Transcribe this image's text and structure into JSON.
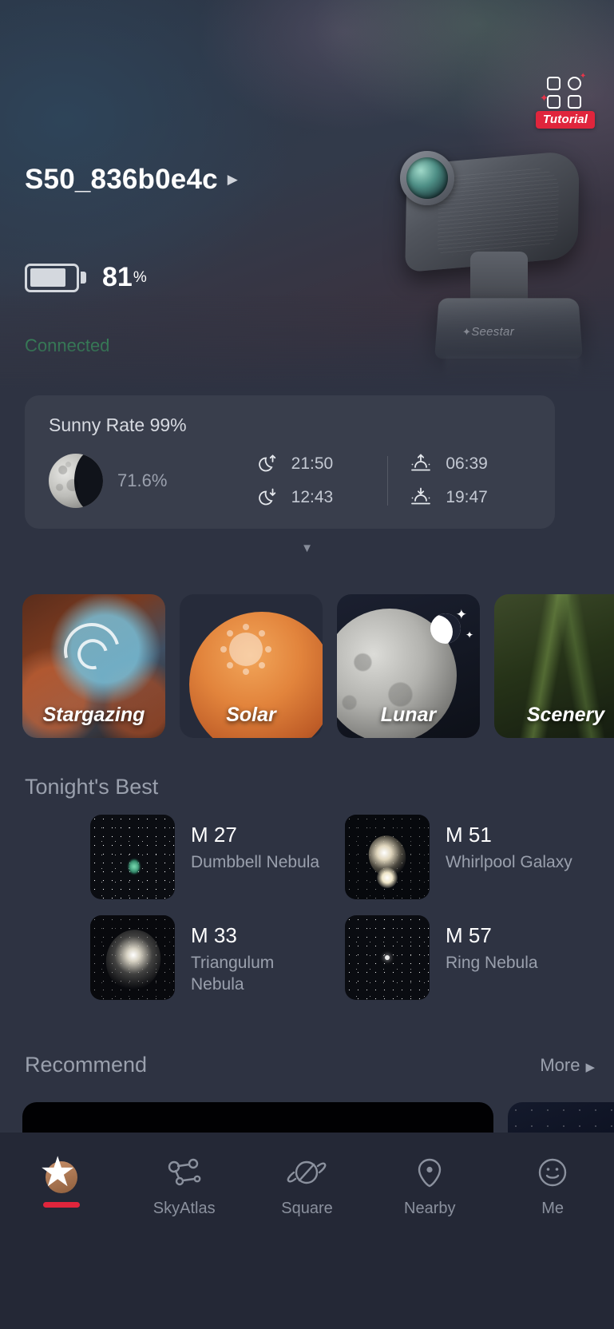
{
  "hero": {
    "tutorial": {
      "label": "Tutorial",
      "icon": "grid-sparkle-icon"
    },
    "device_name": "S50_836b0e4c",
    "device_arrow": "▶",
    "battery": {
      "percent": "81",
      "unit": "%",
      "level": 81
    },
    "connection_status": "Connected",
    "connection_color": "#3fc06a",
    "telescope_brand": "Seestar"
  },
  "info_card": {
    "sunny_rate": "Sunny Rate 99%",
    "moon_illumination": "71.6%",
    "times": [
      {
        "icon": "moonrise-icon",
        "value": "21:50"
      },
      {
        "icon": "moonset-icon",
        "value": "12:43"
      },
      {
        "icon": "sunrise-icon",
        "value": "06:39"
      },
      {
        "icon": "sunset-icon",
        "value": "19:47"
      }
    ],
    "expand_chevron": "⌄"
  },
  "categories": [
    {
      "label": "Stargazing",
      "icon": "galaxy-spiral-icon"
    },
    {
      "label": "Solar",
      "icon": "sun-icon"
    },
    {
      "label": "Lunar",
      "icon": "moon-crescent-icon"
    },
    {
      "label": "Scenery",
      "icon": "landscape-icon"
    }
  ],
  "tonight": {
    "title": "Tonight's Best",
    "objects": [
      {
        "id": "M 27",
        "name": "Dumbbell Nebula"
      },
      {
        "id": "M 51",
        "name": "Whirlpool Galaxy"
      },
      {
        "id": "M 33",
        "name": "Triangulum Nebula"
      },
      {
        "id": "M 57",
        "name": "Ring Nebula"
      }
    ]
  },
  "recommend": {
    "title": "Recommend",
    "more_label": "More",
    "more_arrow": "▶"
  },
  "tabbar": {
    "tabs": [
      {
        "label": "",
        "icon": "home-star-icon",
        "active": true
      },
      {
        "label": "SkyAtlas",
        "icon": "constellation-icon",
        "active": false
      },
      {
        "label": "Square",
        "icon": "planet-icon",
        "active": false
      },
      {
        "label": "Nearby",
        "icon": "location-pin-icon",
        "active": false
      },
      {
        "label": "Me",
        "icon": "person-icon",
        "active": false
      }
    ]
  },
  "colors": {
    "accent": "#e0253c",
    "background": "#2e3342",
    "card": "rgba(255,255,255,0.055)",
    "muted_text": "#9aa0ad",
    "connected_green": "#3fc06a"
  }
}
